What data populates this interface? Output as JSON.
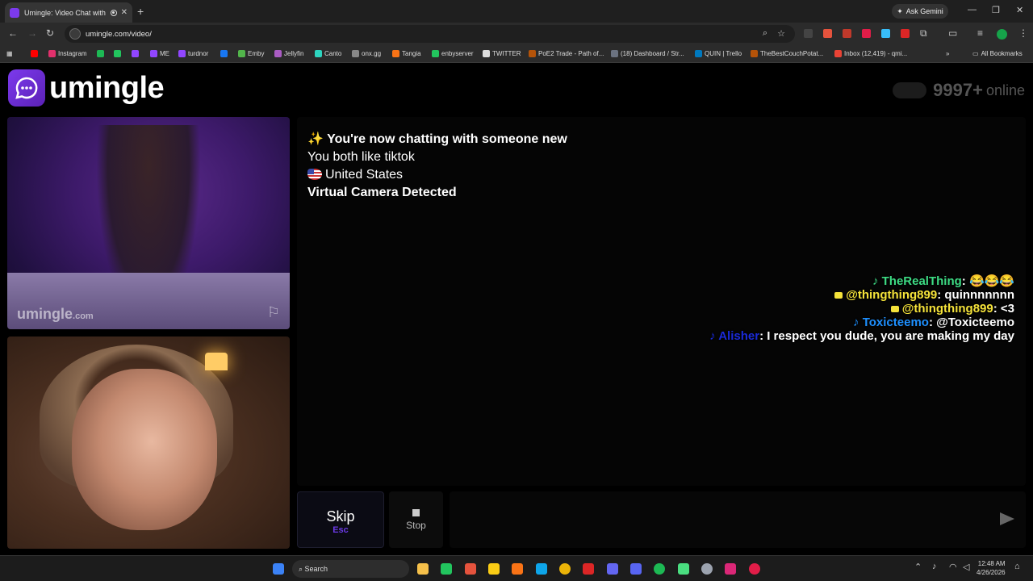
{
  "browser": {
    "tab_title": "Umingle: Video Chat with S",
    "new_tab": "+",
    "ask_gemini": "Ask Gemini",
    "url": "umingle.com/video/",
    "bookmarks": [
      {
        "label": "",
        "color": "#ff0000"
      },
      {
        "label": "Instagram",
        "color": "#e1306c"
      },
      {
        "label": "",
        "color": "#1db954"
      },
      {
        "label": "",
        "color": "#22c55e"
      },
      {
        "label": "",
        "color": "#9146ff"
      },
      {
        "label": "ME",
        "color": "#9146ff"
      },
      {
        "label": "turdnor",
        "color": "#9146ff"
      },
      {
        "label": "",
        "color": "#1877f2"
      },
      {
        "label": "Emby",
        "color": "#52b54b"
      },
      {
        "label": "Jellyfin",
        "color": "#aa5cc3"
      },
      {
        "label": "Canto",
        "color": "#2dd4bf"
      },
      {
        "label": "onx.gg",
        "color": "#888888"
      },
      {
        "label": "Tangia",
        "color": "#f97316"
      },
      {
        "label": "enbyserver",
        "color": "#22c55e"
      },
      {
        "label": "TWITTER",
        "color": "#dddddd"
      },
      {
        "label": "PoE2 Trade - Path of...",
        "color": "#b45309"
      },
      {
        "label": "(18) Dashboard / Str...",
        "color": "#6b7280"
      },
      {
        "label": "QUIN | Trello",
        "color": "#0079bf"
      },
      {
        "label": "TheBestCouchPotat...",
        "color": "#b45309"
      },
      {
        "label": "Inbox (12,419) - qmi...",
        "color": "#ea4335"
      }
    ],
    "all_bookmarks": "All Bookmarks"
  },
  "header": {
    "logo_text": "umingle",
    "online_count": "9997+",
    "online_label": "online"
  },
  "video": {
    "watermark_main": "umingle",
    "watermark_suffix": ".com"
  },
  "chat": {
    "system_messages": [
      "✨ You're now chatting with someone new",
      "You both like tiktok",
      "United States",
      "Virtual Camera Detected"
    ],
    "stream_overlay": [
      {
        "user": "TheRealThing",
        "text": ": 😂😂😂",
        "color_class": "g",
        "icon": "♪"
      },
      {
        "user": "@thingthing899",
        "text": ": quinnnnnnn",
        "color_class": "y",
        "icon": ""
      },
      {
        "user": "@thingthing899",
        "text": ": <3",
        "color_class": "y",
        "icon": ""
      },
      {
        "user": "Toxicteemo",
        "text": ": @Toxicteemo",
        "color_class": "b",
        "icon": "♪"
      },
      {
        "user": "Alisher",
        "text": ": I respect you dude, you are making my day",
        "color_class": "db",
        "icon": "♪"
      }
    ]
  },
  "controls": {
    "skip_label": "Skip",
    "skip_key": "Esc",
    "stop_label": "Stop",
    "message_placeholder": ""
  },
  "taskbar": {
    "search_label": "Search",
    "time": "12:48 AM",
    "date": "4/26/2026"
  }
}
